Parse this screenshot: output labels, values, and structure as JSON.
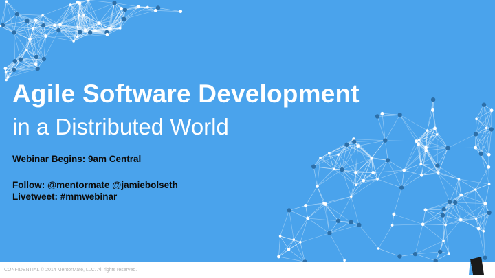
{
  "slide": {
    "title_line1": "Agile Software Development",
    "title_line2": "in a Distributed World",
    "webinar_begins": "Webinar Begins: 9am Central",
    "follow": "Follow: @mentormate @jamiebolseth",
    "livetweet": "Livetweet: #mmwebinar"
  },
  "footer": {
    "confidential": "CONFIDENTIAL © 2014 MentorMate, LLC. All rights reserved."
  },
  "colors": {
    "background": "#4aa3ec",
    "title_text": "#ffffff",
    "body_text": "#0b0b0b",
    "network_line": "#ffffff",
    "node_dark": "#2d6fa8",
    "logo": "#1a1a1a"
  },
  "icons": {
    "network_top_left": "network-graph-decoration",
    "network_bottom_right": "network-graph-decoration",
    "logo": "mentormate-logo"
  }
}
